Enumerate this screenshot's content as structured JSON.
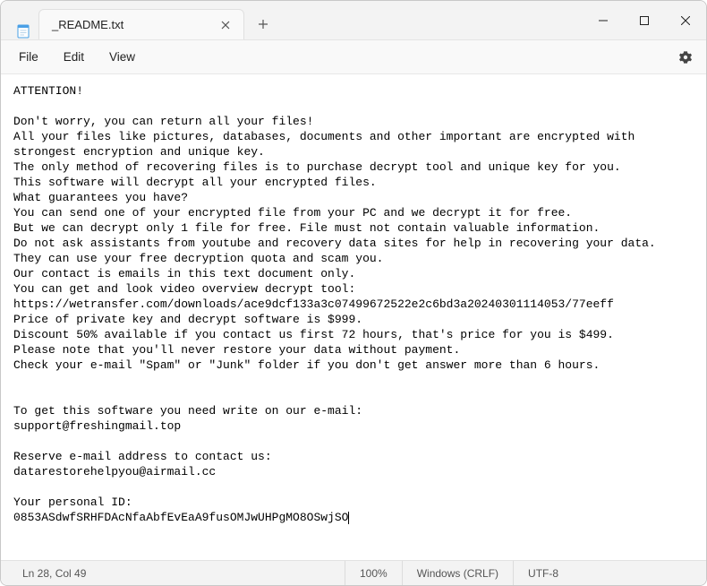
{
  "titlebar": {
    "tab_title": "_README.txt"
  },
  "menu": {
    "file": "File",
    "edit": "Edit",
    "view": "View"
  },
  "content": {
    "text": "ATTENTION!\n\nDon't worry, you can return all your files!\nAll your files like pictures, databases, documents and other important are encrypted with strongest encryption and unique key.\nThe only method of recovering files is to purchase decrypt tool and unique key for you.\nThis software will decrypt all your encrypted files.\nWhat guarantees you have?\nYou can send one of your encrypted file from your PC and we decrypt it for free.\nBut we can decrypt only 1 file for free. File must not contain valuable information.\nDo not ask assistants from youtube and recovery data sites for help in recovering your data.\nThey can use your free decryption quota and scam you.\nOur contact is emails in this text document only.\nYou can get and look video overview decrypt tool:\nhttps://wetransfer.com/downloads/ace9dcf133a3c07499672522e2c6bd3a20240301114053/77eeff\nPrice of private key and decrypt software is $999.\nDiscount 50% available if you contact us first 72 hours, that's price for you is $499.\nPlease note that you'll never restore your data without payment.\nCheck your e-mail \"Spam\" or \"Junk\" folder if you don't get answer more than 6 hours.\n\n\nTo get this software you need write on our e-mail:\nsupport@freshingmail.top\n\nReserve e-mail address to contact us:\ndatarestorehelpyou@airmail.cc\n\nYour personal ID:\n0853ASdwfSRHFDAcNfaAbfEvEaA9fusOMJwUHPgMO8OSwjSO"
  },
  "status": {
    "position": "Ln 28, Col 49",
    "zoom": "100%",
    "line_ending": "Windows (CRLF)",
    "encoding": "UTF-8"
  }
}
